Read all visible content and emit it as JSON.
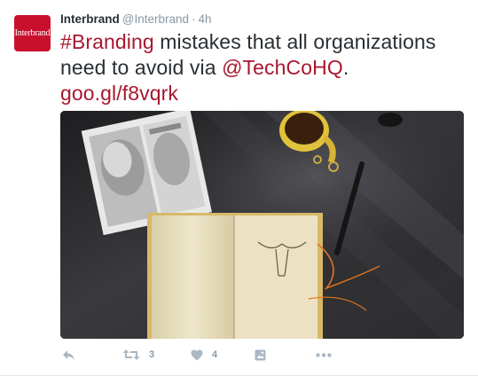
{
  "tweet": {
    "avatar_text": "Interbrand",
    "author_name": "Interbrand",
    "author_handle": "@Interbrand",
    "separator": "·",
    "timestamp": "4h",
    "text": {
      "hashtag": "#Branding",
      "body": " mistakes that all organizations need to avoid via ",
      "mention": "@TechCoHQ",
      "period": ".",
      "link": "goo.gl/f8vqrk"
    },
    "actions": {
      "reply_icon": "reply-icon",
      "retweet_icon": "retweet-icon",
      "retweet_count": "3",
      "like_icon": "heart-icon",
      "like_count": "4",
      "share_icon": "media-share-icon",
      "more_icon": "more-icon"
    }
  },
  "colors": {
    "brand_red": "#c8102e",
    "link_red": "#a8172e",
    "meta_gray": "#8899a6",
    "icon_gray": "#a9b8c4"
  }
}
